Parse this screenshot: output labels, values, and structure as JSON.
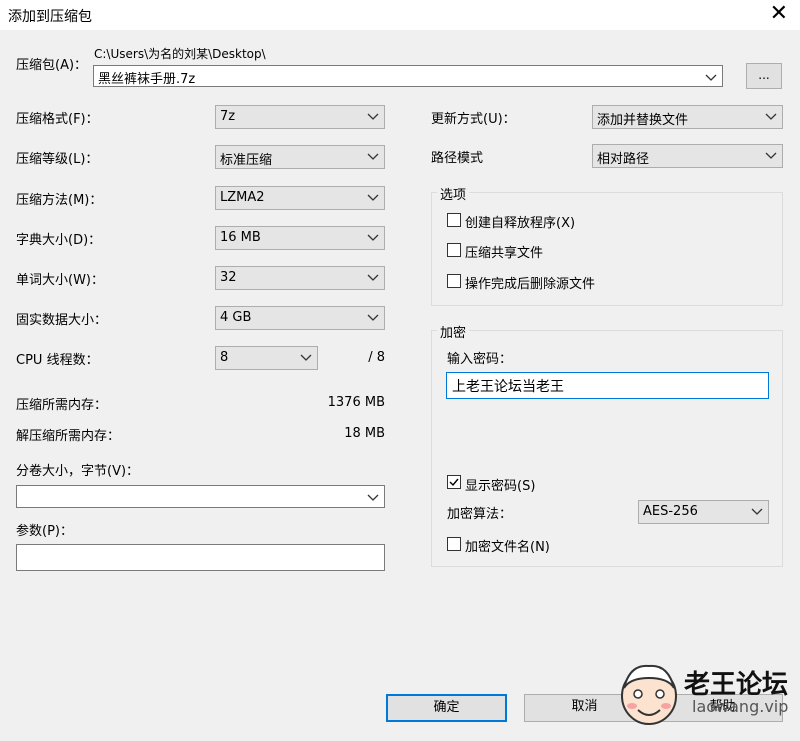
{
  "window": {
    "title": "添加到压缩包",
    "close_glyph": "✕"
  },
  "archive": {
    "label": "压缩包(A)：",
    "path": "C:\\Users\\为名的刘某\\Desktop\\",
    "name": "黑丝裤袜手册.7z",
    "browse_label": "..."
  },
  "left": {
    "format": {
      "label": "压缩格式(F)：",
      "value": "7z"
    },
    "level": {
      "label": "压缩等级(L)：",
      "value": "标准压缩"
    },
    "method": {
      "label": "压缩方法(M)：",
      "value": "LZMA2"
    },
    "dict": {
      "label": "字典大小(D)：",
      "value": "16 MB"
    },
    "word": {
      "label": "单词大小(W)：",
      "value": "32"
    },
    "solid": {
      "label": "固实数据大小：",
      "value": "4 GB"
    },
    "cpu": {
      "label": "CPU 线程数：",
      "value": "8",
      "total": "/ 8"
    },
    "mem_compress": {
      "label": "压缩所需内存：",
      "value": "1376 MB"
    },
    "mem_decompress": {
      "label": "解压缩所需内存：",
      "value": "18 MB"
    },
    "volume": {
      "label": "分卷大小，字节(V)：",
      "value": ""
    },
    "params": {
      "label": "参数(P)：",
      "value": ""
    }
  },
  "right": {
    "update": {
      "label": "更新方式(U)：",
      "value": "添加并替换文件"
    },
    "pathmode": {
      "label": "路径模式",
      "value": "相对路径"
    },
    "options": {
      "title": "选项",
      "sfx": {
        "label": "创建自释放程序(X)",
        "checked": false
      },
      "shared": {
        "label": "压缩共享文件",
        "checked": false
      },
      "delete": {
        "label": "操作完成后删除源文件",
        "checked": false
      }
    },
    "encryption": {
      "title": "加密",
      "pw_label": "输入密码：",
      "password": "上老王论坛当老王",
      "show": {
        "label": "显示密码(S)",
        "checked": true
      },
      "method_label": "加密算法：",
      "method": "AES-256",
      "encrypt_names": {
        "label": "加密文件名(N)",
        "checked": false
      }
    }
  },
  "buttons": {
    "ok": "确定",
    "cancel": "取消",
    "help": "帮助"
  },
  "watermark": {
    "text": "老王论坛",
    "url": "laowang.vip"
  }
}
